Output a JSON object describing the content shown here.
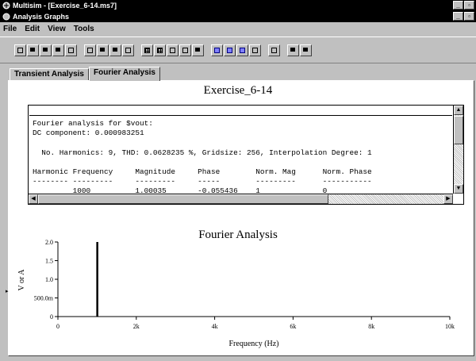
{
  "window": {
    "title": "Multisim - [Exercise_6-14.ms7]",
    "sub_title": "Analysis Graphs"
  },
  "menu": {
    "file": "File",
    "edit": "Edit",
    "view": "View",
    "tools": "Tools"
  },
  "tabs": [
    {
      "label": "Transient Analysis",
      "active": false
    },
    {
      "label": "Fourier Analysis",
      "active": true
    }
  ],
  "graph1": {
    "title": "Exercise_6-14",
    "text_lines": [
      "Fourier analysis for $vout:",
      "DC component: 0.000983251",
      "",
      "  No. Harmonics: 9, THD: 0.0628235 %, Gridsize: 256, Interpolation Degree: 1",
      "",
      "Harmonic Frequency     Magnitude     Phase        Norm. Mag      Norm. Phase",
      "-------- ---------     ---------     -----        ---------      -----------",
      "         1000          1.00035       -0.055436    1              0"
    ]
  },
  "chart_data": {
    "type": "bar",
    "title": "Fourier Analysis",
    "xlabel": "Frequency (Hz)",
    "ylabel": "V or A",
    "xlim": [
      0,
      10000
    ],
    "ylim": [
      0,
      2.0
    ],
    "xticks": [
      "0",
      "2k",
      "4k",
      "6k",
      "8k",
      "10k"
    ],
    "yticks": [
      "0",
      "500.0m",
      "1.0",
      "1.5",
      "2.0"
    ],
    "series": [
      {
        "x": [
          1000
        ],
        "values": [
          2.0
        ]
      }
    ],
    "grid": false
  }
}
